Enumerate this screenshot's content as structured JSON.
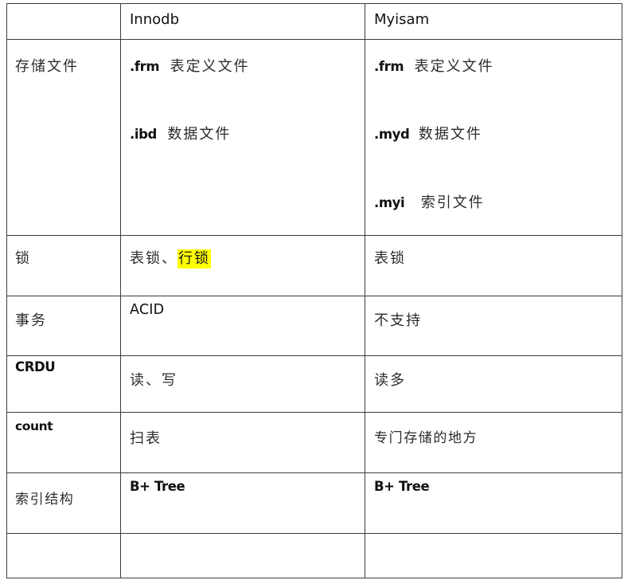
{
  "table": {
    "columns": [
      {
        "key": "feature",
        "header": ""
      },
      {
        "key": "innodb",
        "header": "Innodb"
      },
      {
        "key": "myisam",
        "header": "Myisam"
      }
    ],
    "rows": [
      {
        "name": "storage-files",
        "feature": "存储文件",
        "innodb_lines": [
          {
            "code": ".frm",
            "desc": "表定义文件"
          },
          {
            "code": ".ibd",
            "desc": "数据文件"
          }
        ],
        "myisam_lines": [
          {
            "code": ".frm",
            "desc": "表定义文件"
          },
          {
            "code": ".myd",
            "desc": "数据文件"
          },
          {
            "code": ".myi",
            "desc": "索引文件"
          }
        ]
      },
      {
        "name": "lock",
        "feature": "锁",
        "innodb_plain": "表锁、",
        "innodb_highlight": "行锁",
        "myisam": "表锁"
      },
      {
        "name": "transaction",
        "feature": "事务",
        "innodb": "ACID",
        "myisam": "不支持"
      },
      {
        "name": "crud",
        "feature": "CRDU",
        "innodb": "读、写",
        "myisam": "读多"
      },
      {
        "name": "count",
        "feature": "count",
        "innodb": "扫表",
        "myisam": "专门存储的地方"
      },
      {
        "name": "index-structure",
        "feature": "索引结构",
        "innodb": "B+ Tree",
        "myisam": "B+ Tree"
      },
      {
        "name": "empty",
        "feature": "",
        "innodb": "",
        "myisam": ""
      }
    ]
  },
  "colors": {
    "highlight": "#ffff00",
    "border": "#3d3d3d",
    "text": "#111111",
    "cjk_text": "#2b2b2b",
    "background": "#ffffff"
  }
}
